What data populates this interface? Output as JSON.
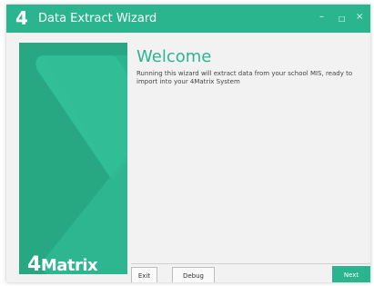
{
  "window": {
    "logo_number": "4",
    "title": "Data Extract Wizard",
    "controls": {
      "minimize": "–",
      "maximize": "□",
      "close": "×"
    }
  },
  "sidebar": {
    "brand_number": "4",
    "brand_name": "Matrix"
  },
  "main": {
    "heading": "Welcome",
    "description": "Running this wizard will extract data from your school MIS, ready to import into your 4Matrix System"
  },
  "buttons": {
    "exit": "Exit",
    "debug": "Debug",
    "next": "Next"
  },
  "colors": {
    "accent": "#2bb58e",
    "background": "#f2f2f2"
  }
}
